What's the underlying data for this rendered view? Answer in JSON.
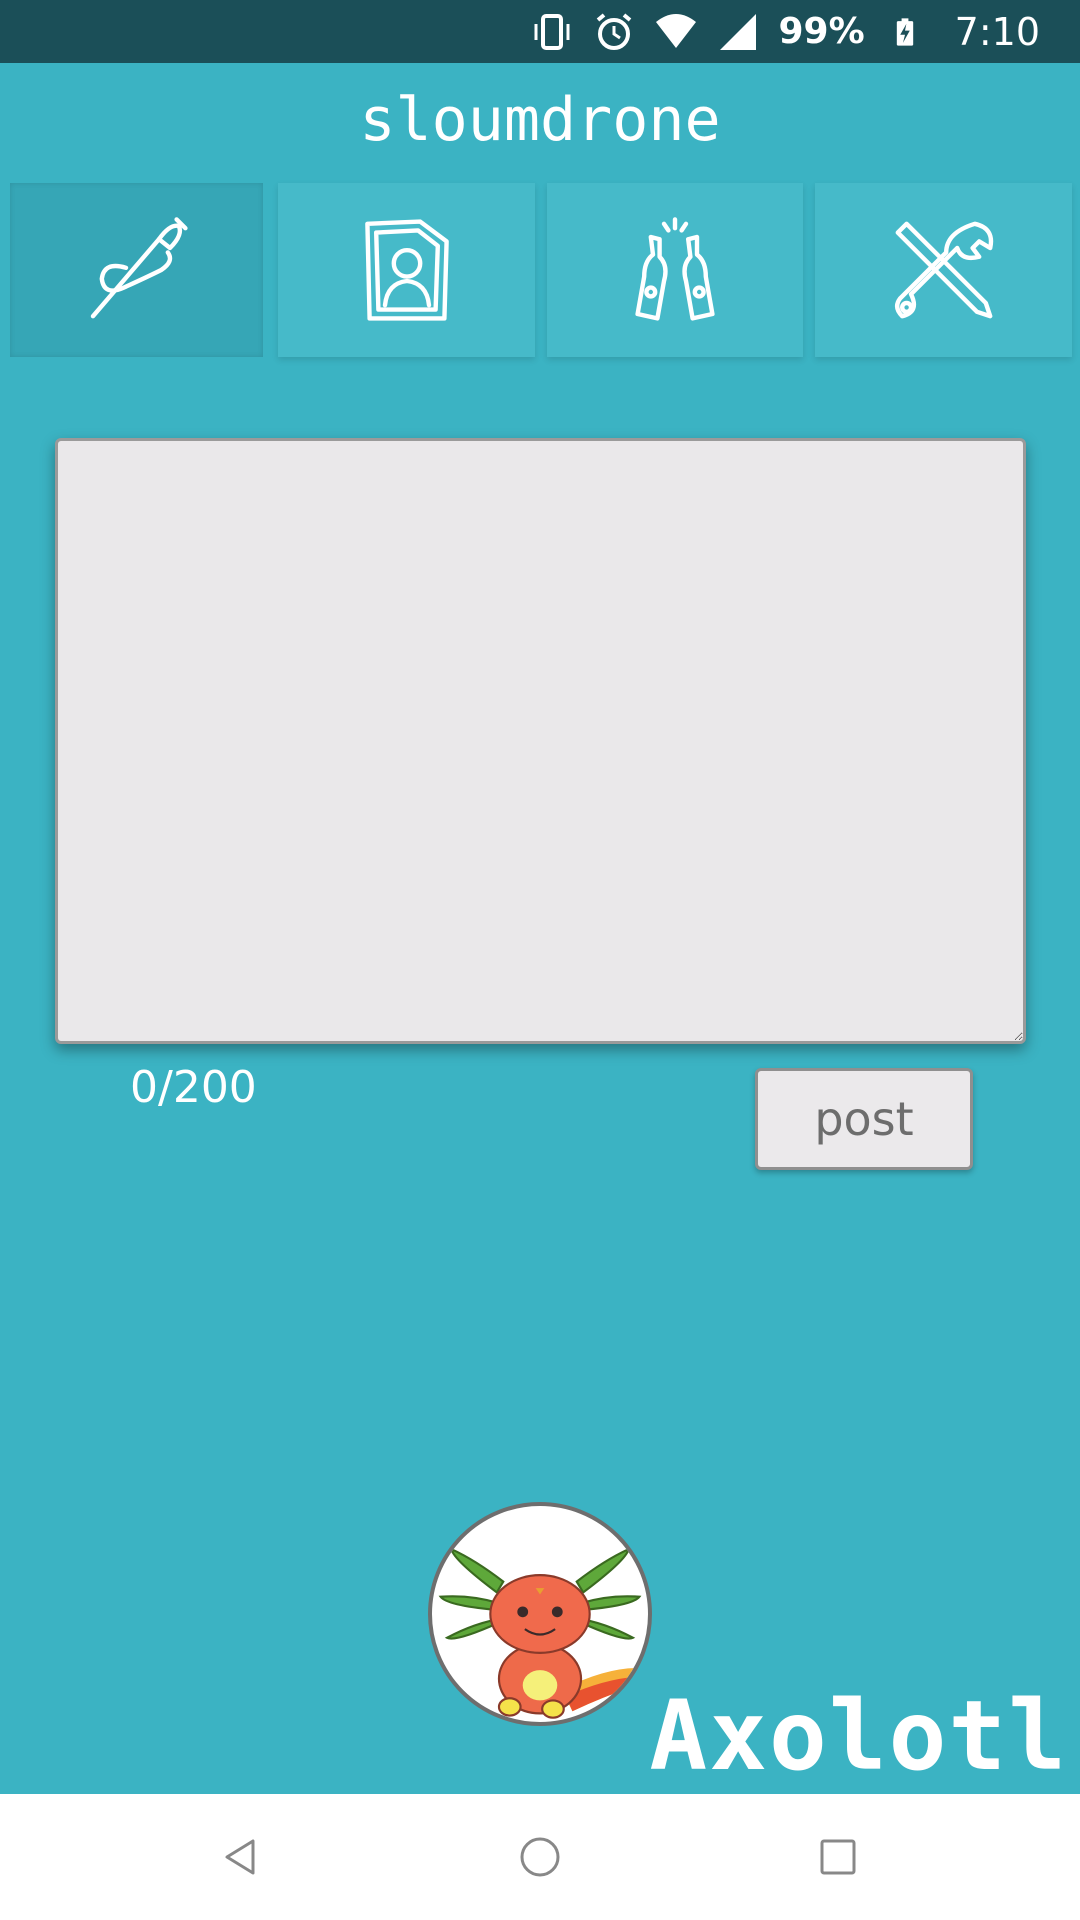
{
  "status_bar": {
    "battery": "99%",
    "time": "7:10",
    "icons": [
      "vibrate-icon",
      "alarm-icon",
      "wifi-icon",
      "signal-icon",
      "battery-charging-icon"
    ]
  },
  "app": {
    "title": "sloumdrone"
  },
  "tabs": [
    {
      "name": "compose",
      "icon": "quill-pen-icon",
      "active": true
    },
    {
      "name": "profile",
      "icon": "profile-card-icon",
      "active": false
    },
    {
      "name": "social",
      "icon": "beer-bottles-icon",
      "active": false
    },
    {
      "name": "settings",
      "icon": "tools-icon",
      "active": false
    }
  ],
  "compose": {
    "text_value": "",
    "placeholder": "",
    "char_counter": "0/200",
    "post_label": "post"
  },
  "profile": {
    "avatar_icon": "axolotl-avatar",
    "username": "Axolotl"
  },
  "nav_bar": {
    "items": [
      "back-icon",
      "home-icon",
      "recents-icon"
    ]
  },
  "colors": {
    "background": "#3bb3c3",
    "status_bar": "#1b4f58",
    "tab": "#46bac9",
    "tab_active": "#36a6b6",
    "text_area": "#eae8ea"
  }
}
